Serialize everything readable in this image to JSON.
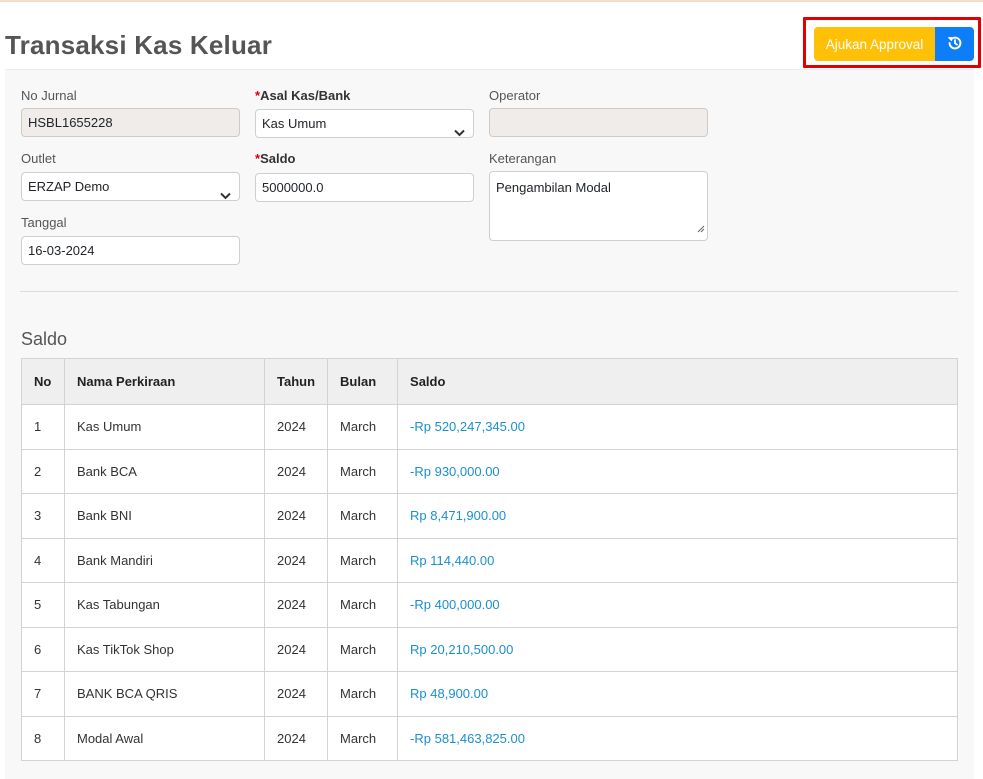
{
  "page": {
    "title": "Transaksi Kas Keluar"
  },
  "actions": {
    "approval_label": "Ajukan Approval",
    "history_icon": "history-icon"
  },
  "form": {
    "no_jurnal": {
      "label": "No Jurnal",
      "value": "HSBL1655228"
    },
    "asal_kas": {
      "required_mark": "*",
      "label": "Asal Kas/Bank",
      "value": "Kas Umum"
    },
    "operator": {
      "label": "Operator",
      "value": ""
    },
    "outlet": {
      "label": "Outlet",
      "value": "ERZAP Demo"
    },
    "saldo": {
      "required_mark": "*",
      "label": "Saldo",
      "value": "5000000.0"
    },
    "keterangan": {
      "label": "Keterangan",
      "value": "Pengambilan Modal"
    },
    "tanggal": {
      "label": "Tanggal",
      "value": "16-03-2024"
    }
  },
  "saldo_section": {
    "title": "Saldo",
    "columns": [
      "No",
      "Nama Perkiraan",
      "Tahun",
      "Bulan",
      "Saldo"
    ],
    "rows": [
      {
        "no": "1",
        "nama": "Kas Umum",
        "tahun": "2024",
        "bulan": "March",
        "saldo": "-Rp 520,247,345.00"
      },
      {
        "no": "2",
        "nama": "Bank BCA",
        "tahun": "2024",
        "bulan": "March",
        "saldo": "-Rp 930,000.00"
      },
      {
        "no": "3",
        "nama": "Bank BNI",
        "tahun": "2024",
        "bulan": "March",
        "saldo": "Rp 8,471,900.00"
      },
      {
        "no": "4",
        "nama": "Bank Mandiri",
        "tahun": "2024",
        "bulan": "March",
        "saldo": "Rp 114,440.00"
      },
      {
        "no": "5",
        "nama": "Kas Tabungan",
        "tahun": "2024",
        "bulan": "March",
        "saldo": "-Rp 400,000.00"
      },
      {
        "no": "6",
        "nama": "Kas TikTok Shop",
        "tahun": "2024",
        "bulan": "March",
        "saldo": "Rp 20,210,500.00"
      },
      {
        "no": "7",
        "nama": "BANK BCA QRIS",
        "tahun": "2024",
        "bulan": "March",
        "saldo": "Rp 48,900.00"
      },
      {
        "no": "8",
        "nama": "Modal Awal",
        "tahun": "2024",
        "bulan": "March",
        "saldo": "-Rp 581,463,825.00"
      }
    ]
  },
  "colors": {
    "approval_button": "#ffc107",
    "history_button": "#0d7ef8",
    "highlight_box": "#e00000",
    "amount_text": "#1a8fd0"
  }
}
